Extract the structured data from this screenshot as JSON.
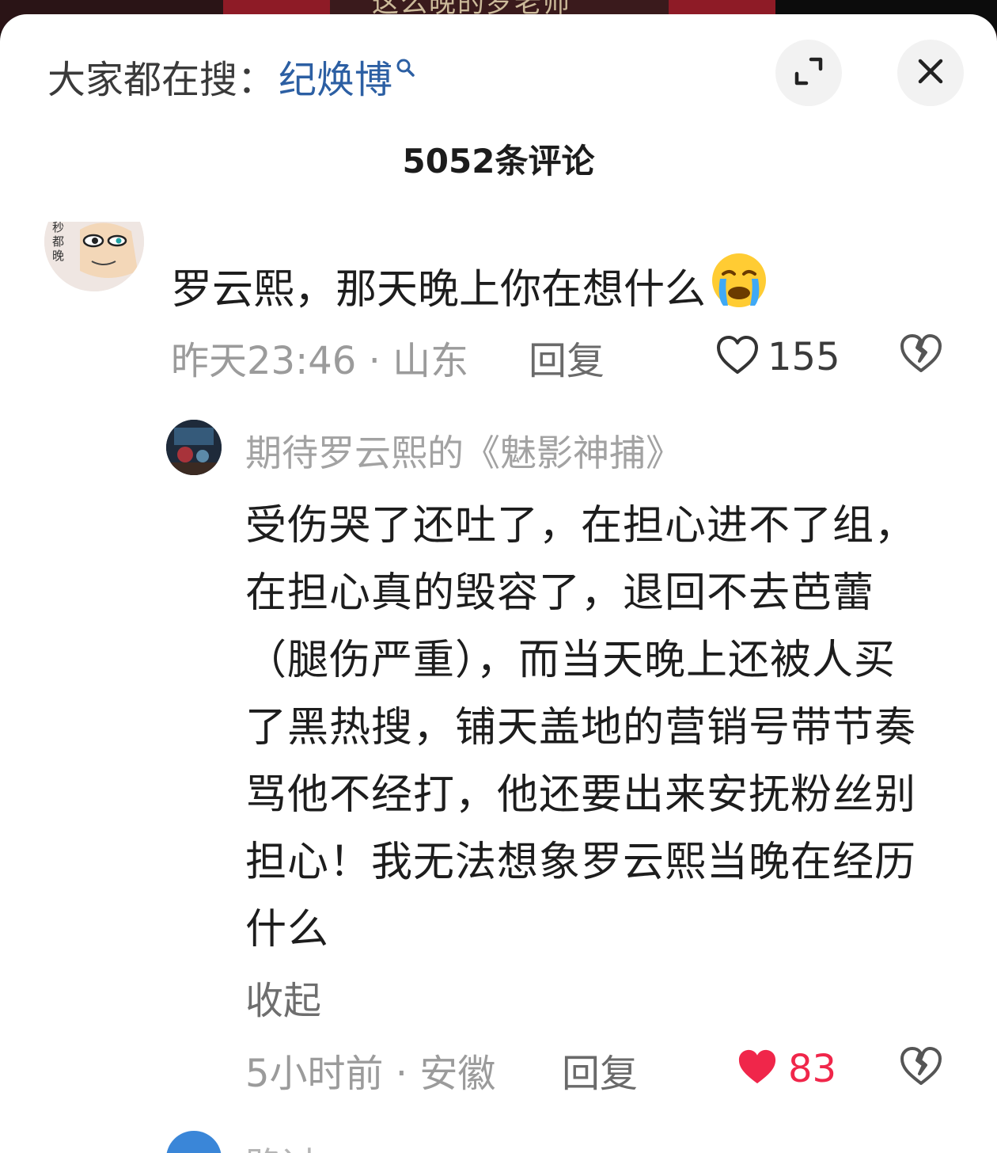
{
  "video": {
    "subtitle": "这么晚的罗老师"
  },
  "header": {
    "search_hint_label": "大家都在搜：",
    "search_keyword": "纪焕博",
    "comment_count": "5052条评论"
  },
  "comments": [
    {
      "avatar_text": "秒都晚",
      "text": "罗云熙，那天晚上你在想什么",
      "emoji": "😭",
      "time_location": "昨天23:46 · 山东",
      "reply_label": "回复",
      "likes": "155",
      "liked": false
    }
  ],
  "reply": {
    "author": "期待罗云熙的《魅影神捕》",
    "body": "受伤哭了还吐了，在担心进不了组，在担心真的毁容了，退回不去芭蕾（腿伤严重），而当天晚上还被人买了黑热搜，铺天盖地的营销号带节奏骂他不经打，他还要出来安抚粉丝别担心！我无法想象罗云熙当晚在经历什么",
    "collapse_label": "收起",
    "time_location": "5小时前 · 安徽",
    "reply_label": "回复",
    "likes": "83",
    "liked": true
  },
  "next_reply": {
    "author": "路过"
  },
  "colors": {
    "keyword": "#2c5fa3",
    "like_active": "#f0264a",
    "meta": "#9b9b9b"
  },
  "icons": [
    "search-icon",
    "expand-icon",
    "close-icon",
    "heart-icon",
    "broken-heart-icon"
  ]
}
